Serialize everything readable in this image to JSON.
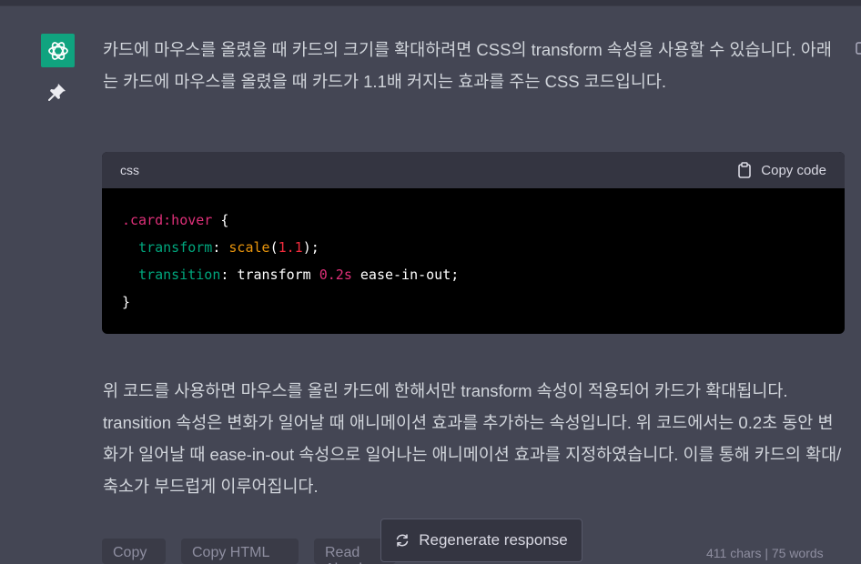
{
  "message": {
    "paragraph1": "카드에 마우스를 올렸을 때 카드의 크기를 확대하려면 CSS의 transform 속성을 사용할 수 있습니다. 아래는 카드에 마우스를 올렸을 때 카드가 1.1배 커지는 효과를 주는 CSS 코드입니다.",
    "paragraph2": "위 코드를 사용하면 마우스를 올린 카드에 한해서만 transform 속성이 적용되어 카드가 확대됩니다. transition 속성은 변화가 일어날 때 애니메이션 효과를 추가하는 속성입니다. 위 코드에서는 0.2초 동안 변화가 일어날 때 ease-in-out 속성으로 일어나는 애니메이션 효과를 지정하였습니다. 이를 통해 카드의 확대/축소가 부드럽게 이루어집니다."
  },
  "code_block": {
    "language": "css",
    "copy_label": "Copy code",
    "lines": {
      "selector": ".card:hover",
      "open_brace": " {",
      "prop1": "transform",
      "colon1": ": ",
      "fn_name": "scale",
      "paren_open": "(",
      "fn_arg": "1.1",
      "paren_close": ");",
      "prop2": "transition",
      "colon2": ": ",
      "value2a": "transform ",
      "value2b": "0.2s",
      "value2c": " ease-in-out;",
      "close_brace": "}"
    }
  },
  "actions": {
    "regenerate_label": "Regenerate response",
    "copy_label": "Copy",
    "copy_html_label": "Copy HTML",
    "read_aloud_label": "Read Aloud",
    "stats": "411 chars | 75 words"
  },
  "colors": {
    "background": "#444654",
    "avatar": "#10a37f",
    "code_header": "#343541",
    "code_body": "#000000"
  },
  "icons": [
    "openai-logo-icon",
    "pin-icon",
    "clipboard-icon",
    "refresh-icon"
  ]
}
